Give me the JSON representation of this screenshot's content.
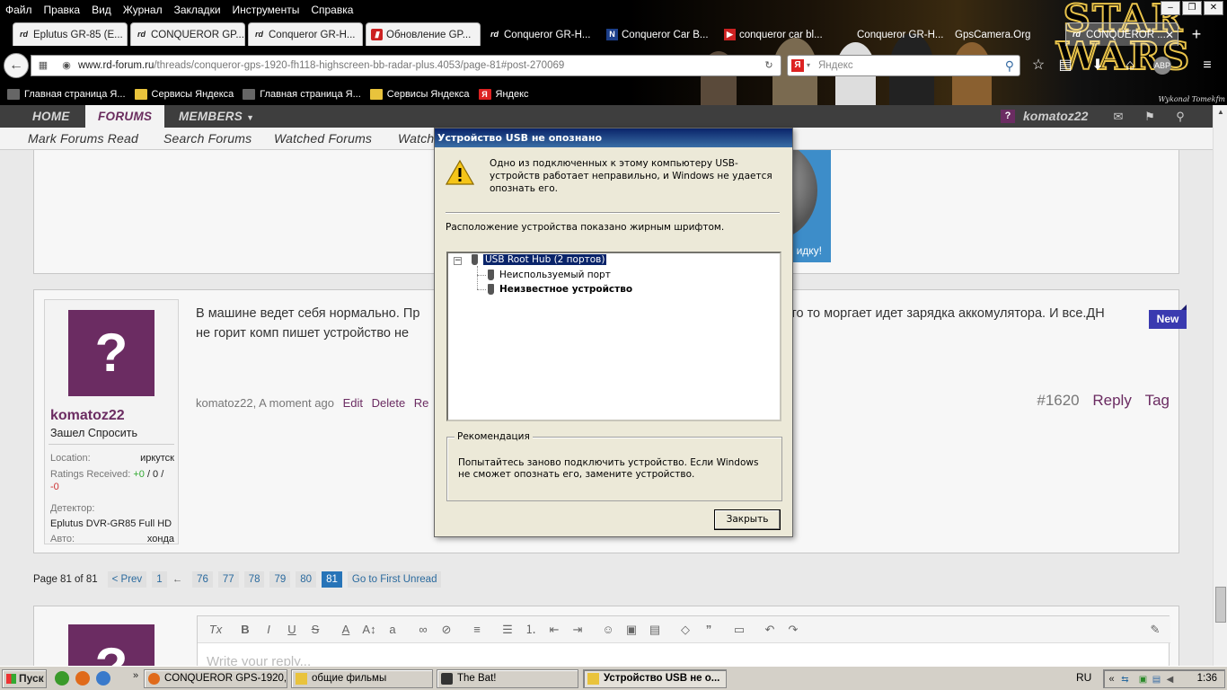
{
  "browser": {
    "menu": [
      "Файл",
      "Правка",
      "Вид",
      "Журнал",
      "Закладки",
      "Инструменты",
      "Справка"
    ],
    "tabs": [
      {
        "label": "Eplutus GR-85 (E...",
        "icon": "rd"
      },
      {
        "label": "CONQUEROR GP...",
        "icon": "rd"
      },
      {
        "label": "Conqueror GR-H...",
        "icon": "rd"
      },
      {
        "label": "Обновление GP...",
        "icon": "record"
      },
      {
        "label": "Conqueror GR-H...",
        "icon": "rd"
      },
      {
        "label": "Conqueror Car B...",
        "icon": "N"
      },
      {
        "label": "conqueror car bl...",
        "icon": "youtube"
      },
      {
        "label": "Conqueror GR-H...",
        "icon": "blank"
      },
      {
        "label": "GpsCamera.Org",
        "icon": "blank"
      },
      {
        "label": "CONQUEROR ...",
        "icon": "rd"
      }
    ],
    "url_host": "www.rd-forum.ru",
    "url_path": "/threads/conqueror-gps-1920-fh118-highscreen-bb-radar-plus.4053/page-81#post-270069",
    "search_placeholder": "Яндекс",
    "bookmarks": [
      "Главная страница Я...",
      "Сервисы Яндекса",
      "Главная страница Я...",
      "Сервисы Яндекса",
      "Яндекс"
    ],
    "theme_logo_line1": "STAR",
    "theme_logo_line2": "WARS",
    "theme_credit": "Wykonał Tomekfm"
  },
  "forum": {
    "nav_main": [
      "HOME",
      "FORUMS",
      "MEMBERS"
    ],
    "username_top": "komatoz22",
    "nav_sub": [
      "Mark Forums Read",
      "Search Forums",
      "Watched Forums",
      "Watch"
    ],
    "ad_text": "идку!",
    "post": {
      "username": "komatoz22",
      "user_title": "Зашел Спросить",
      "location_label": "Location:",
      "location": "иркутск",
      "ratings_label": "Ratings Received:",
      "ratings_pos": "+0",
      "ratings_mid": " / 0 /",
      "ratings_neg": "-0",
      "detector_label": "Детектор:",
      "detector": "Eplutus DVR-GR85 Full HD",
      "auto_label": "Авто:",
      "auto": "хонда",
      "text_line1_left": "В машине ведет себя нормально. Пр",
      "text_line1_right": "то то моргает идет зарядка аккомулятора. И все.ДН",
      "text_line2": "не горит комп пишет устройство не",
      "meta": "komatoz22, A moment ago",
      "edit": "Edit",
      "delete": "Delete",
      "reply_short": "Re",
      "number": "#1620",
      "reply": "Reply",
      "tag": "Tag",
      "new_badge": "New"
    },
    "pagination": {
      "label": "Page 81 of 81",
      "prev": "< Prev",
      "pages": [
        "1",
        "←",
        "76",
        "77",
        "78",
        "79",
        "80",
        "81"
      ],
      "current": "81",
      "first_unread": "Go to First Unread"
    },
    "editor_placeholder": "Write your reply..."
  },
  "dialog": {
    "title": "Устройство USB не опознано",
    "message": "Одно из подключенных к этому компьютеру USB-устройств работает неправильно, и Windows не удается опознать его.",
    "location_text": "Расположение устройства показано жирным шрифтом.",
    "tree": [
      "USB Root Hub (2 портов)",
      "Неиспользуемый порт",
      "Неизвестное устройство"
    ],
    "rec_title": "Рекомендация",
    "rec_text": "Попытайтесь заново подключить устройство. Если Windows не сможет опознать его, замените устройство.",
    "close": "Закрыть"
  },
  "taskbar": {
    "start": "Пуск",
    "buttons": [
      "CONQUEROR GPS-1920,...",
      "общие фильмы",
      "The Bat!",
      "Устройство USB не о..."
    ],
    "lang": "RU",
    "time": "1:36"
  }
}
